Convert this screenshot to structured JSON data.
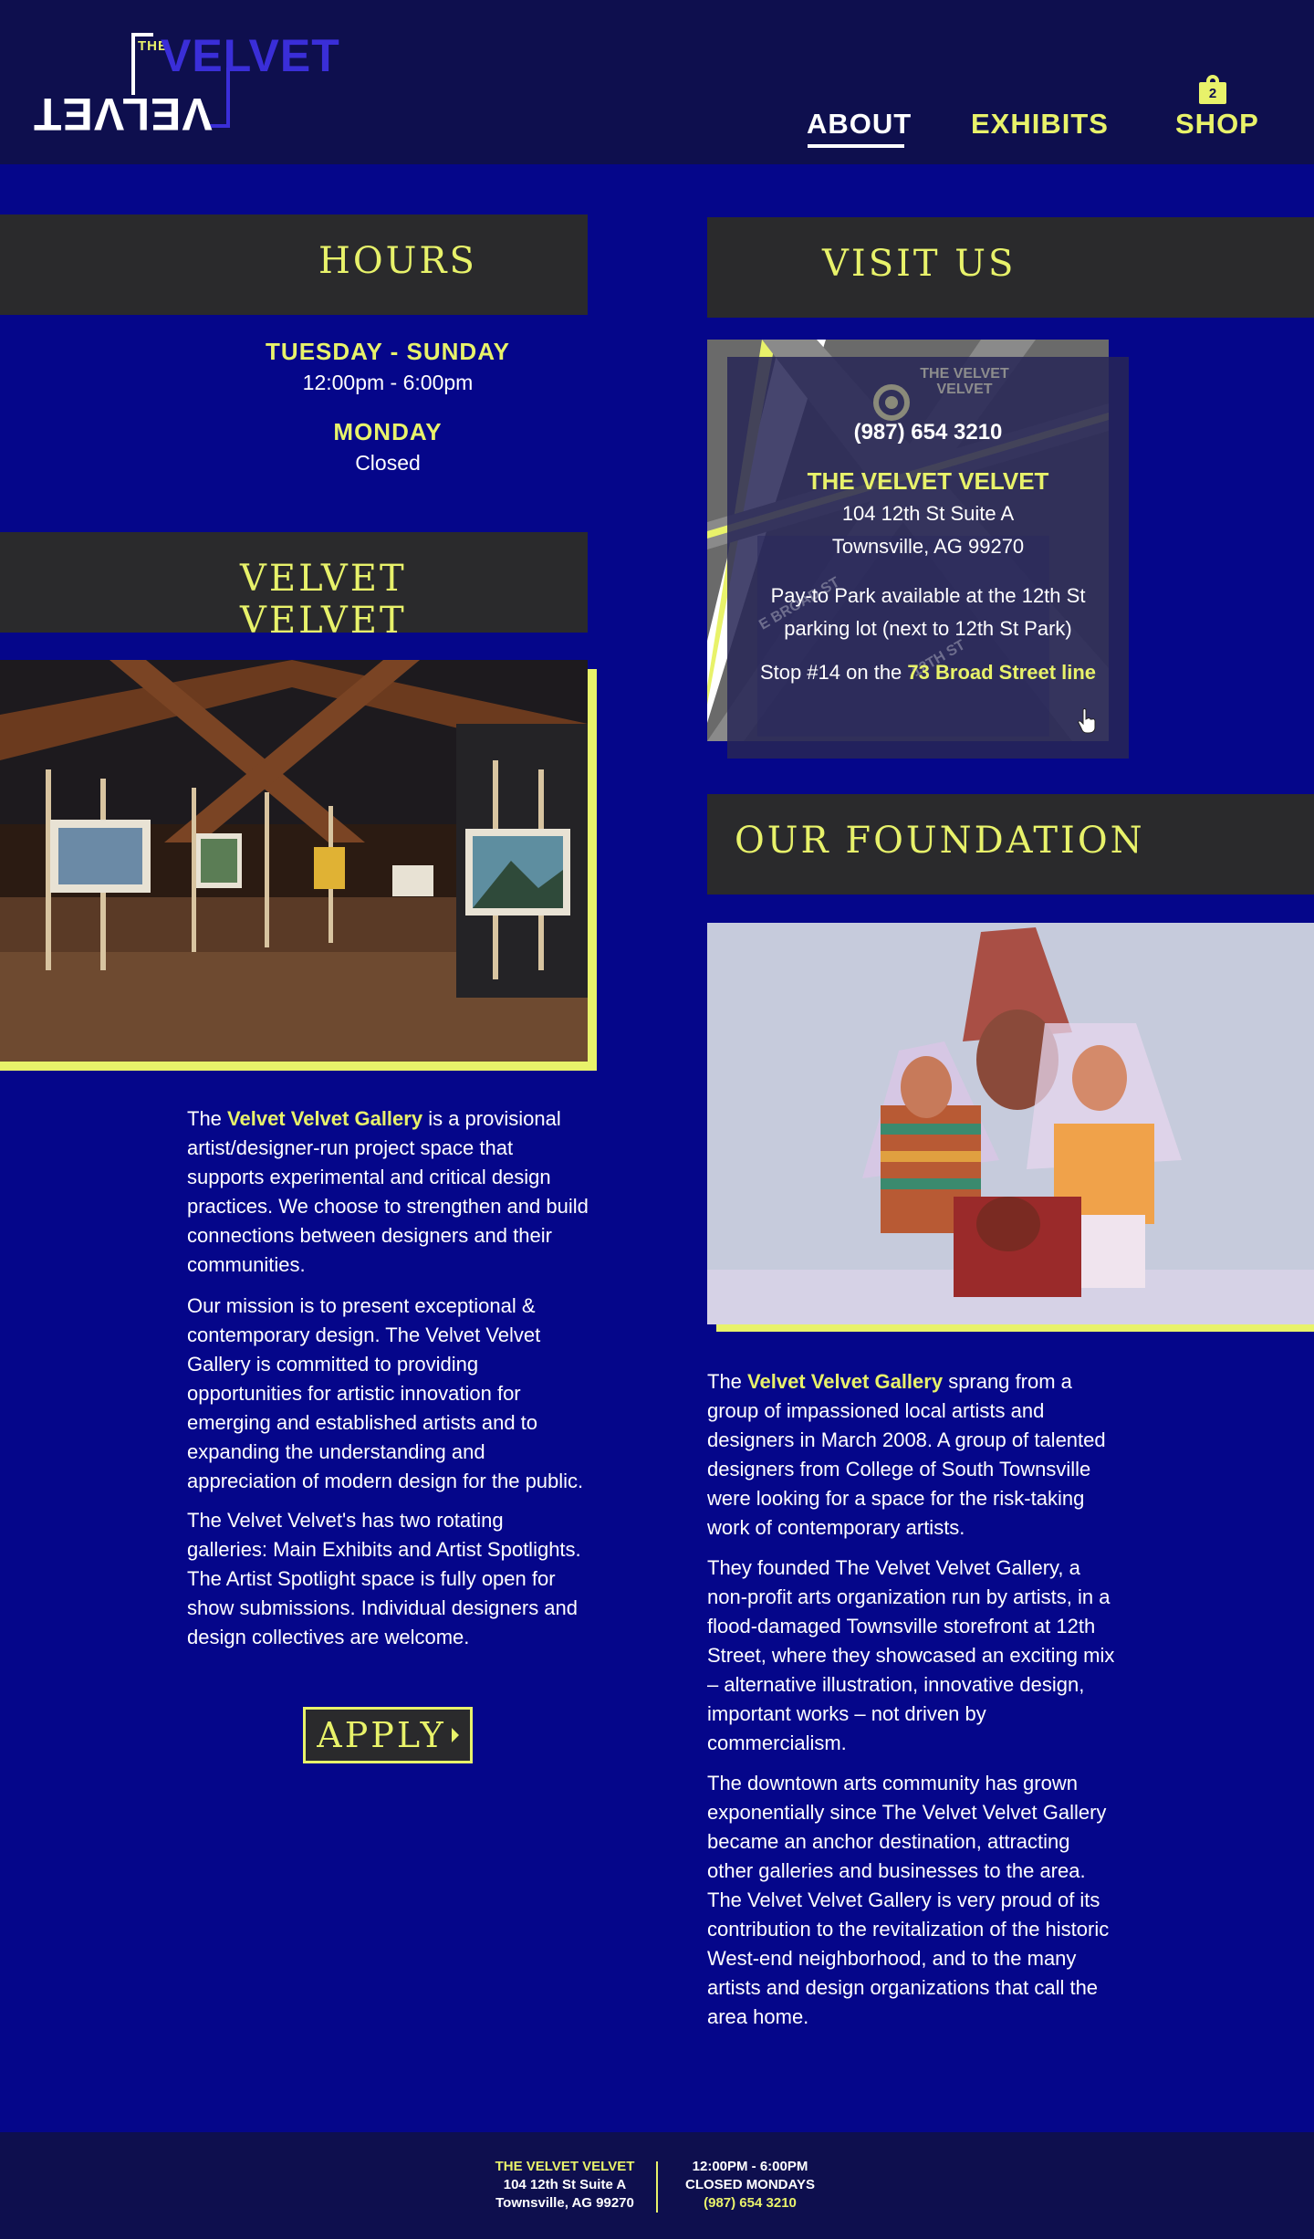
{
  "header": {
    "logo": {
      "the": "THE",
      "word_top": "VELVET",
      "word_mirror": "VELVET"
    },
    "nav": {
      "about": "ABOUT",
      "exhibits": "EXHIBITS",
      "shop": "SHOP"
    },
    "cart_count": "2"
  },
  "hours": {
    "title": "HOURS",
    "day1": "TUESDAY - SUNDAY",
    "time1": "12:00pm - 6:00pm",
    "day2": "MONDAY",
    "time2": "Closed"
  },
  "about": {
    "title": "VELVET VELVET",
    "p1_pre": "The ",
    "p1_hl": "Velvet Velvet Gallery",
    "p1_post": " is a provisional artist/designer-run project space that supports experimental and critical design practices. We choose to strengthen and build connections between designers and their communities.",
    "p2": "Our mission is to present exceptional & contemporary design. The Velvet Velvet Gallery is committed to providing opportunities for artistic innovation for emerging and established artists and to expanding the understanding and appreciation of modern design for the public.",
    "p3": "The Velvet Velvet's has two rotating galleries: Main Exhibits and Artist Spotlights. The Artist Spotlight space is fully open for show submissions. Individual designers and design collectives are welcome.",
    "apply": "APPLY"
  },
  "visit": {
    "title": "VISIT US",
    "map_label_1": "THE VELVET",
    "map_label_2": "VELVET",
    "map_street_1": "E BROAD ST",
    "map_street_2": "12TH ST",
    "phone": "(987) 654 3210",
    "name": "THE VELVET VELVET",
    "address1": "104 12th St Suite A",
    "address2": "Townsville, AG 99270",
    "parking1": "Pay-to Park available at the 12th St",
    "parking2": "parking lot (next to 12th St Park)",
    "stop_pre": "Stop #14 on the ",
    "stop_hl": "73 Broad Street line"
  },
  "foundation": {
    "title": "OUR FOUNDATION",
    "p1_pre": "The ",
    "p1_hl": "Velvet Velvet Gallery",
    "p1_post": " sprang from a group of impassioned local artists and designers in March 2008. A group of talented designers from College of South Townsville were looking for a space for the risk-taking work of contemporary artists.",
    "p2": "They founded The Velvet Velvet Gallery, a non-profit arts organization run by artists, in a flood-damaged Townsville storefront at 12th Street, where they showcased an exciting mix – alternative illustration, innovative design, important works – not driven by commercialism.",
    "p3": "The downtown arts community has grown exponentially since  The Velvet Velvet Gallery became an anchor destination, attracting other galleries and businesses to the area. The Velvet Velvet Gallery is very proud of its contribution to the revitalization of the historic West-end neighborhood, and to the many artists and design organizations that call the area home."
  },
  "footer": {
    "name": "THE VELVET VELVET",
    "address1": "104 12th St Suite A",
    "address2": "Townsville, AG 99270",
    "hours": "12:00PM - 6:00PM",
    "closed": "CLOSED MONDAYS",
    "phone": "(987) 654 3210"
  },
  "colors": {
    "background": "#05068a",
    "header": "#0e0f4e",
    "accent": "#e8f26a",
    "banner": "#2a2a2c",
    "logo_blue": "#3a2ed8"
  },
  "icons": [
    "shopping-bag-icon",
    "pointer-cursor-icon",
    "map-pin-icon",
    "chevron-right-icon"
  ]
}
